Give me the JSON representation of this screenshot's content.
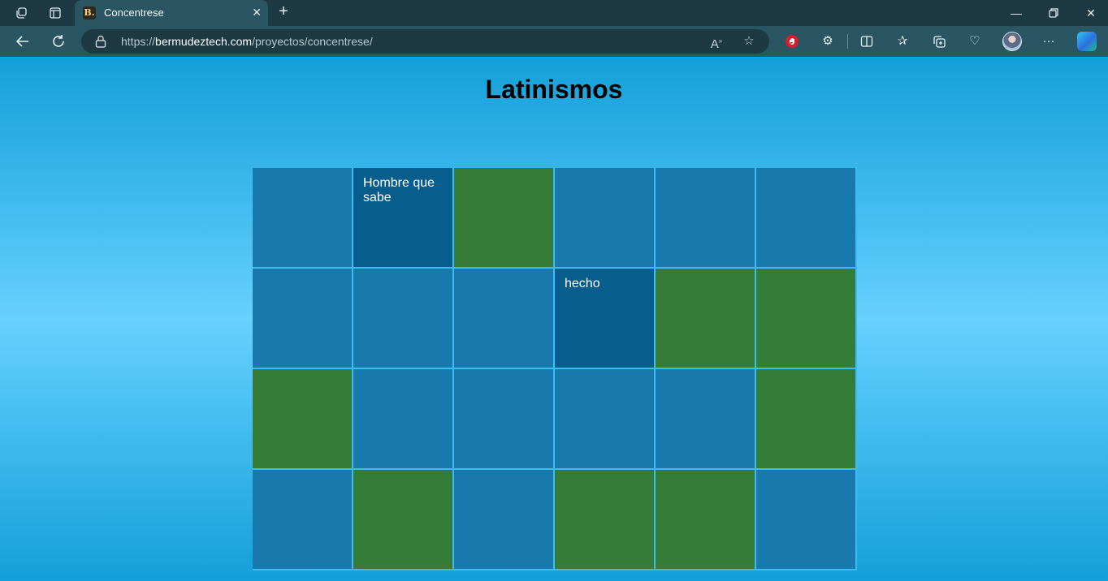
{
  "browser": {
    "tab": {
      "favicon_text": "B.",
      "title": "Concentrese"
    },
    "address": {
      "prefix": "https://",
      "domain": "bermudeztech.com",
      "path": "/proyectos/concentrese/"
    }
  },
  "game": {
    "title": "Latinismos",
    "grid": {
      "rows": 4,
      "columns": 6
    },
    "state_colors": {
      "hidden": "#1779ac",
      "matched": "#367c39",
      "flipped": "#075e8c"
    },
    "cards": [
      {
        "state": "hidden",
        "text": ""
      },
      {
        "state": "flipped",
        "text": "Hombre que sabe"
      },
      {
        "state": "matched",
        "text": ""
      },
      {
        "state": "hidden",
        "text": ""
      },
      {
        "state": "hidden",
        "text": ""
      },
      {
        "state": "hidden",
        "text": ""
      },
      {
        "state": "hidden",
        "text": ""
      },
      {
        "state": "hidden",
        "text": ""
      },
      {
        "state": "hidden",
        "text": ""
      },
      {
        "state": "flipped",
        "text": "hecho"
      },
      {
        "state": "matched",
        "text": ""
      },
      {
        "state": "matched",
        "text": ""
      },
      {
        "state": "matched",
        "text": ""
      },
      {
        "state": "hidden",
        "text": ""
      },
      {
        "state": "hidden",
        "text": ""
      },
      {
        "state": "hidden",
        "text": ""
      },
      {
        "state": "hidden",
        "text": ""
      },
      {
        "state": "matched",
        "text": ""
      },
      {
        "state": "hidden",
        "text": ""
      },
      {
        "state": "matched",
        "text": ""
      },
      {
        "state": "hidden",
        "text": ""
      },
      {
        "state": "matched",
        "text": ""
      },
      {
        "state": "matched",
        "text": ""
      },
      {
        "state": "hidden",
        "text": ""
      }
    ]
  }
}
